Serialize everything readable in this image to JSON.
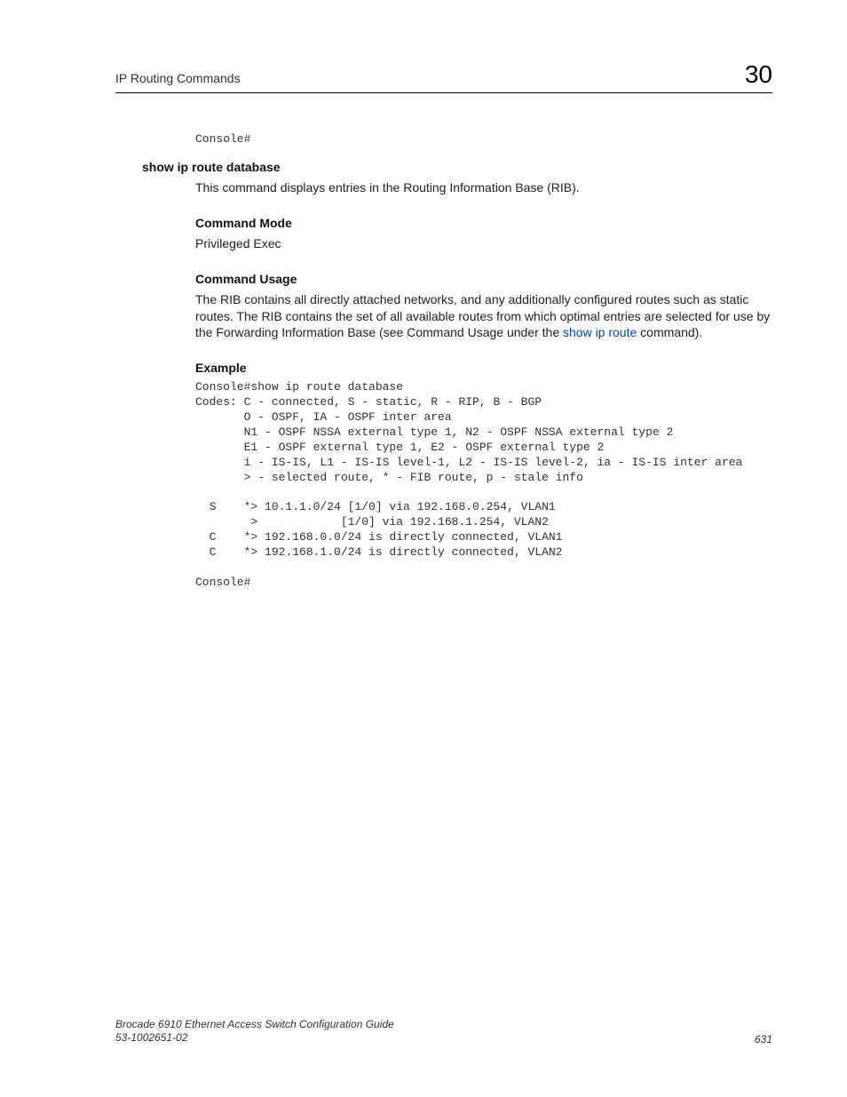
{
  "header": {
    "title": "IP Routing Commands",
    "chapter": "30"
  },
  "top_console": "Console#",
  "command_name": "show ip route database",
  "description": "This command displays entries in the Routing Information Base (RIB).",
  "mode_heading": "Command Mode",
  "mode_text": "Privileged Exec",
  "usage_heading": "Command Usage",
  "usage_text_pre": "The RIB contains all directly attached networks, and any additionally configured routes such as static routes. The RIB contains the set of all available routes from which optimal entries are selected for use by the Forwarding Information Base (see Command Usage under the ",
  "usage_link": "show ip route",
  "usage_text_post": " command).",
  "example_heading": "Example",
  "example_block": "Console#show ip route database\nCodes: C - connected, S - static, R - RIP, B - BGP\n       O - OSPF, IA - OSPF inter area\n       N1 - OSPF NSSA external type 1, N2 - OSPF NSSA external type 2\n       E1 - OSPF external type 1, E2 - OSPF external type 2\n       i - IS-IS, L1 - IS-IS level-1, L2 - IS-IS level-2, ia - IS-IS inter area\n       > - selected route, * - FIB route, p - stale info\n\n  S    *> 10.1.1.0/24 [1/0] via 192.168.0.254, VLAN1\n        >            [1/0] via 192.168.1.254, VLAN2\n  C    *> 192.168.0.0/24 is directly connected, VLAN1\n  C    *> 192.168.1.0/24 is directly connected, VLAN2\n\nConsole#",
  "footer": {
    "book": "Brocade 6910 Ethernet Access Switch Configuration Guide",
    "docnum": "53-1002651-02",
    "page": "631"
  }
}
